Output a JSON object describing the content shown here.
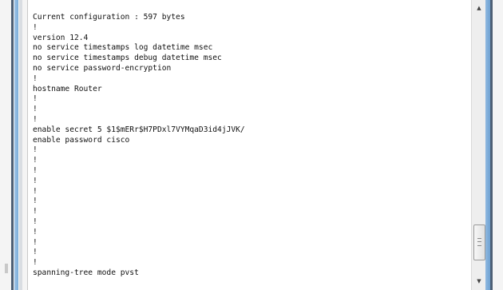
{
  "terminal": {
    "lines": [
      "Current configuration : 597 bytes",
      "!",
      "version 12.4",
      "no service timestamps log datetime msec",
      "no service timestamps debug datetime msec",
      "no service password-encryption",
      "!",
      "hostname Router",
      "!",
      "!",
      "!",
      "enable secret 5 $1$mERr$H7PDxl7VYMqaD3id4jJVK/",
      "enable password cisco",
      "!",
      "!",
      "!",
      "!",
      "!",
      "!",
      "!",
      "!",
      "!",
      "!",
      "!",
      "!",
      "spanning-tree mode pvst"
    ]
  },
  "scrollbar": {
    "up_arrow_icon": "triangle-up-icon",
    "down_arrow_icon": "triangle-down-icon",
    "up_glyph": "▲",
    "down_glyph": "▼",
    "position_fraction": 0.85
  },
  "colors": {
    "frame_blue": "#7aaedb",
    "frame_dark": "#4d5f75",
    "text": "#111111"
  }
}
